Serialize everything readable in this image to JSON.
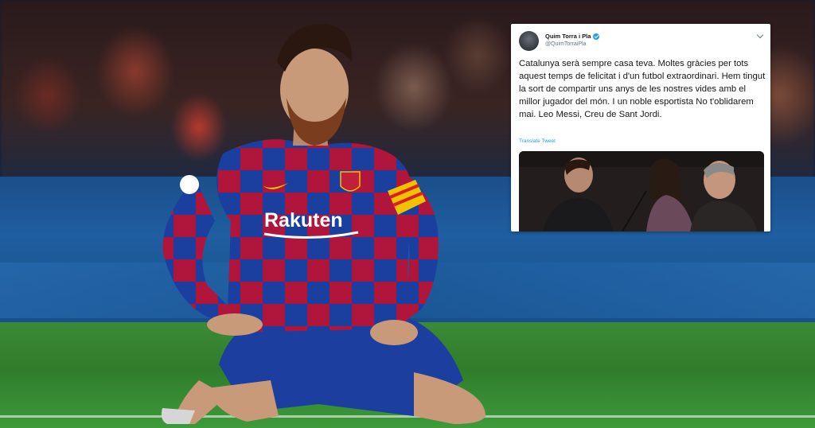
{
  "tweet": {
    "author_name": "Quim Torra i Pla",
    "handle": "@QuimTorraiPla",
    "text": "Catalunya serà sempre casa teva. Moltes gràcies per tots aquest temps de felicitat i d'un futbol extraordinari. Hem tingut la sort de compartir uns anys de les nostres vides amb el millor jugador del món. I un noble esportista No t'oblidarem mai. Leo Messi, Creu de Sant Jordi.",
    "translate_label": "Translate Tweet",
    "verified_icon": "verified-badge-icon",
    "menu_icon": "chevron-down-icon"
  },
  "photo": {
    "jersey_sponsor": "Rakuten"
  },
  "colors": {
    "twitter_blue": "#1da1f2",
    "barca_blue": "#1b3f9e",
    "barca_red": "#b0163c",
    "pitch_green": "#3b8a36"
  }
}
